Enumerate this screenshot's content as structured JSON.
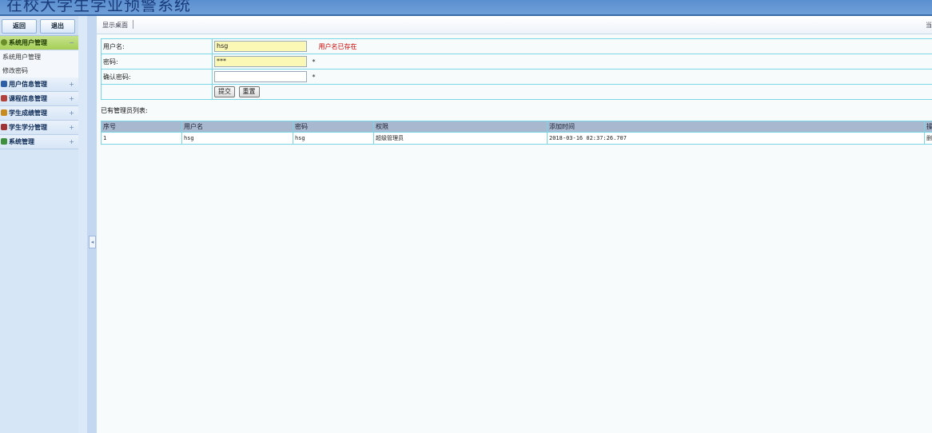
{
  "app": {
    "title": "在校大学生学业预警系统"
  },
  "sidebar": {
    "back_label": "返回",
    "exit_label": "退出",
    "categories": [
      {
        "label": "系统用户管理",
        "toggle": "−",
        "icon_color": "#6a8f2a",
        "items": [
          {
            "label": "系统用户管理"
          },
          {
            "label": "修改密码"
          }
        ]
      },
      {
        "label": "用户信息管理",
        "toggle": "+",
        "icon_color": "#2d5fa8"
      },
      {
        "label": "课程信息管理",
        "toggle": "+",
        "icon_color": "#b3403a"
      },
      {
        "label": "学生成绩管理",
        "toggle": "+",
        "icon_color": "#c98b1e"
      },
      {
        "label": "学生学分管理",
        "toggle": "+",
        "icon_color": "#a03333"
      },
      {
        "label": "系统管理",
        "toggle": "+",
        "icon_color": "#3e8f3e"
      }
    ]
  },
  "tabs": {
    "desktop": "显示桌面",
    "right_fragment": "当"
  },
  "form": {
    "username_label": "用户名:",
    "username_value": "hsg",
    "username_error": "用户名已存在",
    "password_label": "密码:",
    "password_value": "***",
    "confirm_label": "确认密码:",
    "confirm_value": "",
    "required_mark": "*",
    "submit_label": "提交",
    "reset_label": "重置"
  },
  "list": {
    "caption": "已有管理员列表:",
    "columns": [
      "序号",
      "用户名",
      "密码",
      "权限",
      "添加时间",
      "操"
    ],
    "rows": [
      [
        "1",
        "hsg",
        "hsg",
        "超级管理员",
        "2018-03-16 02:37:26.707",
        "删"
      ]
    ]
  },
  "colors": {
    "banner": "#5b8fcf",
    "active_menu": "#a6cf55",
    "error": "#d40000",
    "grid_header": "#a7b8cf",
    "grid_border": "#7ad6e6"
  }
}
